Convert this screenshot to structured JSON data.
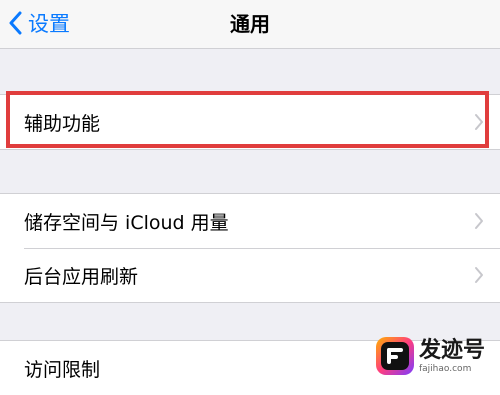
{
  "nav": {
    "back_label": "设置",
    "title": "通用"
  },
  "groups": [
    {
      "rows": [
        {
          "label": "辅助功能",
          "chevron": "chevron-right-icon",
          "highlighted": true
        }
      ]
    },
    {
      "rows": [
        {
          "label": "储存空间与 iCloud 用量",
          "chevron": "chevron-right-icon"
        },
        {
          "label": "后台应用刷新",
          "chevron": "chevron-right-icon"
        }
      ]
    },
    {
      "rows": [
        {
          "label": "访问限制"
        }
      ]
    }
  ],
  "watermark": {
    "name": "发迹号",
    "site": "fajihao.com"
  },
  "colors": {
    "accent": "#0a7aff",
    "highlight": "#e03d3d",
    "background": "#efeff4"
  }
}
